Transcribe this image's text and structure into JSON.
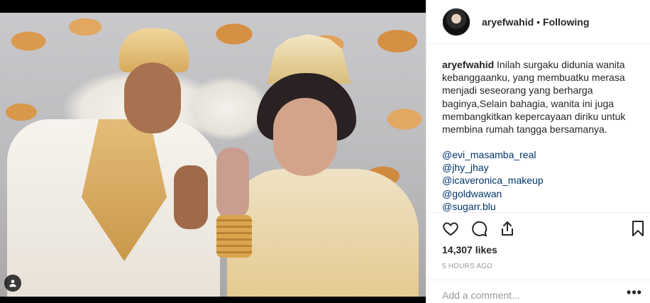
{
  "post": {
    "author": "aryefwahid",
    "separator": "•",
    "follow_status": "Following",
    "caption_user": "aryefwahid",
    "caption_text": "Inilah surgaku didunia wanita kebanggaanku, yang membuatku merasa menjadi seseorang yang berharga baginya,Selain bahagia, wanita ini juga membangkitkan kepercayaan diriku untuk membina rumah tangga bersamanya.",
    "mentions": [
      "@evi_masamba_real",
      "@jhy_jhay",
      "@icaveronica_makeup",
      "@goldwawan",
      "@sugarr.blu"
    ],
    "likes": "14,307 likes",
    "timestamp": "5 HOURS AGO",
    "comment_placeholder": "Add a comment...",
    "more_options": "•••"
  },
  "icons": {
    "like": "heart-icon",
    "comment": "comment-bubble-icon",
    "share": "share-icon",
    "save": "bookmark-icon",
    "multi": "user-tag-icon"
  },
  "colors": {
    "link": "#003569",
    "text": "#262626",
    "muted": "#999999",
    "border": "#efefef"
  }
}
